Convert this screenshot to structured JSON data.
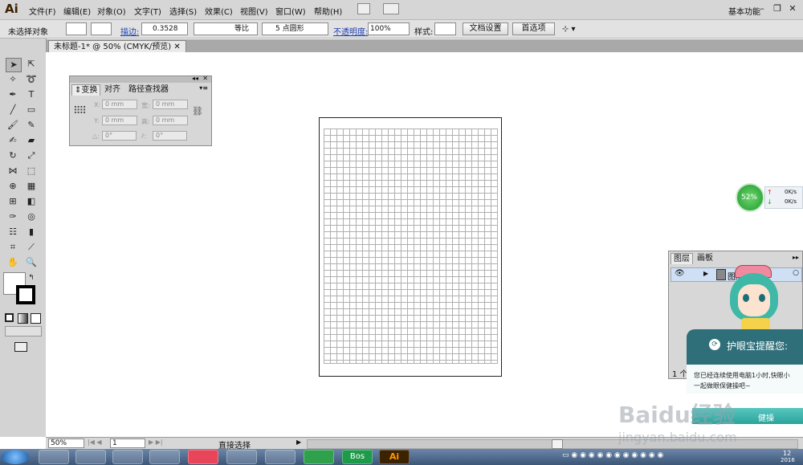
{
  "app": {
    "logo": "Ai"
  },
  "menu": [
    "文件(F)",
    "编辑(E)",
    "对象(O)",
    "文字(T)",
    "选择(S)",
    "效果(C)",
    "视图(V)",
    "窗口(W)",
    "帮助(H)"
  ],
  "workspace": "基本功能",
  "control": {
    "selection": "未选择对象",
    "stroke_label": "描边:",
    "stroke_value": "0.3528",
    "profile": "等比",
    "brush": "5 点圆形",
    "opacity_label": "不透明度:",
    "opacity_value": "100%",
    "style_label": "样式:",
    "doc_setup": "文档设置",
    "preferences": "首选项"
  },
  "document": {
    "tab": "未标题-1* @ 50% (CMYK/预览)"
  },
  "transform_panel": {
    "tabs": [
      "变换",
      "对齐",
      "路径查找器"
    ],
    "x_label": "X:",
    "y_label": "Y:",
    "w_label": "宽:",
    "h_label": "高:",
    "x": "0 mm",
    "y": "0 mm",
    "w": "0 mm",
    "h": "0 mm",
    "rotate": "0°",
    "shear": "0°"
  },
  "layers_panel": {
    "tabs": [
      "图层",
      "画板"
    ],
    "layer_name": "图层",
    "count": "1 个"
  },
  "net_widget": {
    "percent": "52%",
    "up": "0K/s",
    "down": "0K/s"
  },
  "popup": {
    "title": "护眼宝提醒您:",
    "line1": "您已经连续使用电脑1小时,快眼小",
    "line2": "一起做眼保健操吧~",
    "footer": "健操"
  },
  "status": {
    "zoom": "50%",
    "artboard": "1",
    "tool": "直接选择"
  },
  "taskbar": {
    "bos": "Bos",
    "ai": "Ai",
    "clock": "12",
    "date": "2016"
  },
  "watermark": {
    "brand": "Baidu经验",
    "url": "jingyan.baidu.com"
  }
}
